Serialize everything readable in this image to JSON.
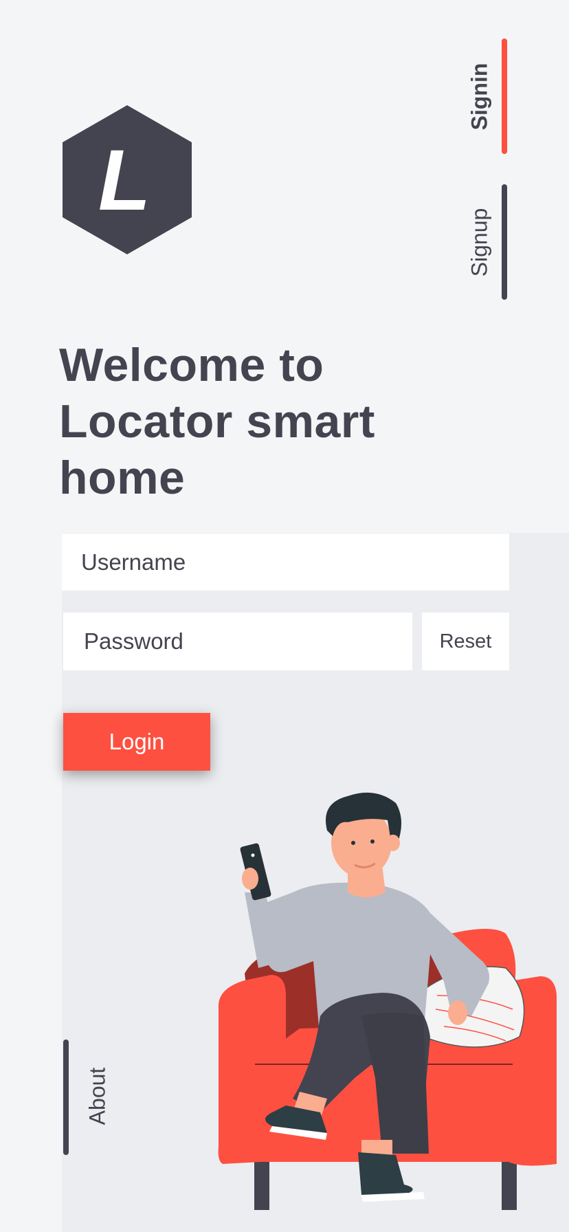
{
  "brand": {
    "logo_letter": "L",
    "logo_color": "#43444f"
  },
  "nav": {
    "signin_label": "Signin",
    "signup_label": "Signup",
    "about_label": "About",
    "active": "Signin",
    "active_color": "#fd5041"
  },
  "headline": "Welcome to Locator smart home",
  "form": {
    "username_placeholder": "Username",
    "password_placeholder": "Password",
    "reset_label": "Reset",
    "login_label": "Login"
  },
  "illustration": {
    "icon": "man-on-armchair-with-phone"
  }
}
